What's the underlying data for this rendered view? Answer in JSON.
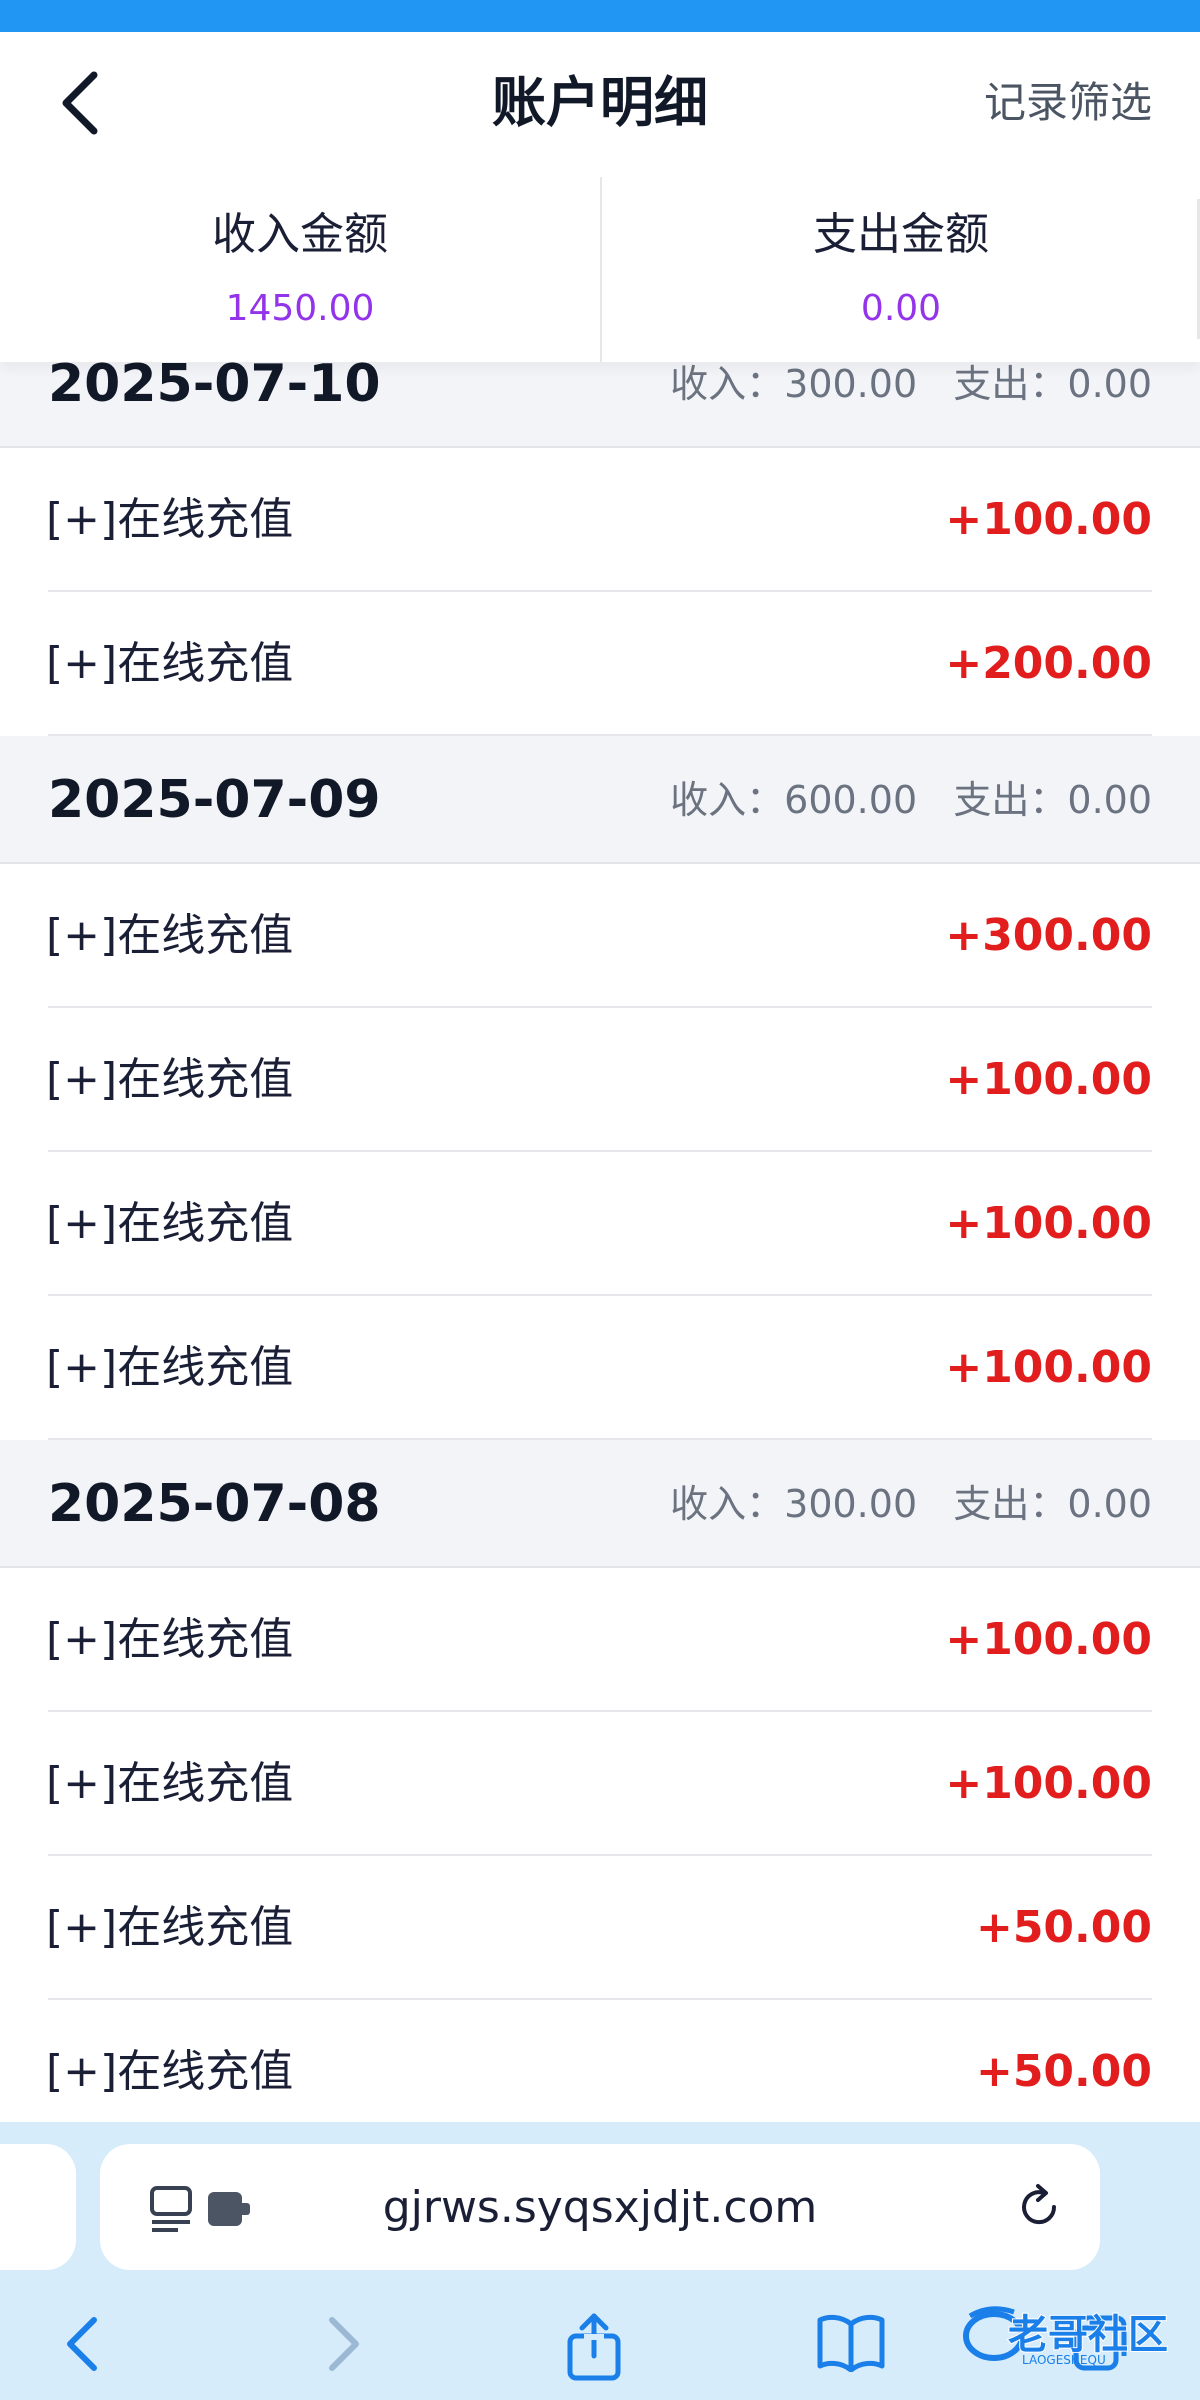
{
  "nav": {
    "title": "账户明细",
    "filter_label": "记录筛选"
  },
  "summary": {
    "income_label": "收入金额",
    "income_value": "1450.00",
    "expense_label": "支出金额",
    "expense_value": "0.00"
  },
  "groups": [
    {
      "date": "2025-07-10",
      "income_label": "收入：",
      "income": "300.00",
      "expense_label": "支出：",
      "expense": "0.00",
      "rows": [
        {
          "label": "[+]在线充值",
          "amount": "+100.00"
        },
        {
          "label": "[+]在线充值",
          "amount": "+200.00"
        }
      ]
    },
    {
      "date": "2025-07-09",
      "income_label": "收入：",
      "income": "600.00",
      "expense_label": "支出：",
      "expense": "0.00",
      "rows": [
        {
          "label": "[+]在线充值",
          "amount": "+300.00"
        },
        {
          "label": "[+]在线充值",
          "amount": "+100.00"
        },
        {
          "label": "[+]在线充值",
          "amount": "+100.00"
        },
        {
          "label": "[+]在线充值",
          "amount": "+100.00"
        }
      ]
    },
    {
      "date": "2025-07-08",
      "income_label": "收入：",
      "income": "300.00",
      "expense_label": "支出：",
      "expense": "0.00",
      "rows": [
        {
          "label": "[+]在线充值",
          "amount": "+100.00"
        },
        {
          "label": "[+]在线充值",
          "amount": "+100.00"
        },
        {
          "label": "[+]在线充值",
          "amount": "+50.00"
        },
        {
          "label": "[+]在线充值",
          "amount": "+50.00"
        }
      ]
    }
  ],
  "browser": {
    "url": "gjrws.syqsxjdjt.com",
    "icons": [
      "reader-icon",
      "extension-icon",
      "reload-icon",
      "back-icon",
      "forward-icon",
      "share-icon",
      "bookmarks-icon",
      "tabs-icon"
    ]
  },
  "watermark": {
    "text": "老哥社区",
    "subtext": "LAOGESHEQU"
  },
  "colors": {
    "top_strip": "#2196f3",
    "summary_value": "#9333ea",
    "amount_positive": "#e11d1d",
    "group_header_bg": "#f3f4f8",
    "browser_bg": "#d6ecfb",
    "browser_icon": "#1a7fe8"
  }
}
